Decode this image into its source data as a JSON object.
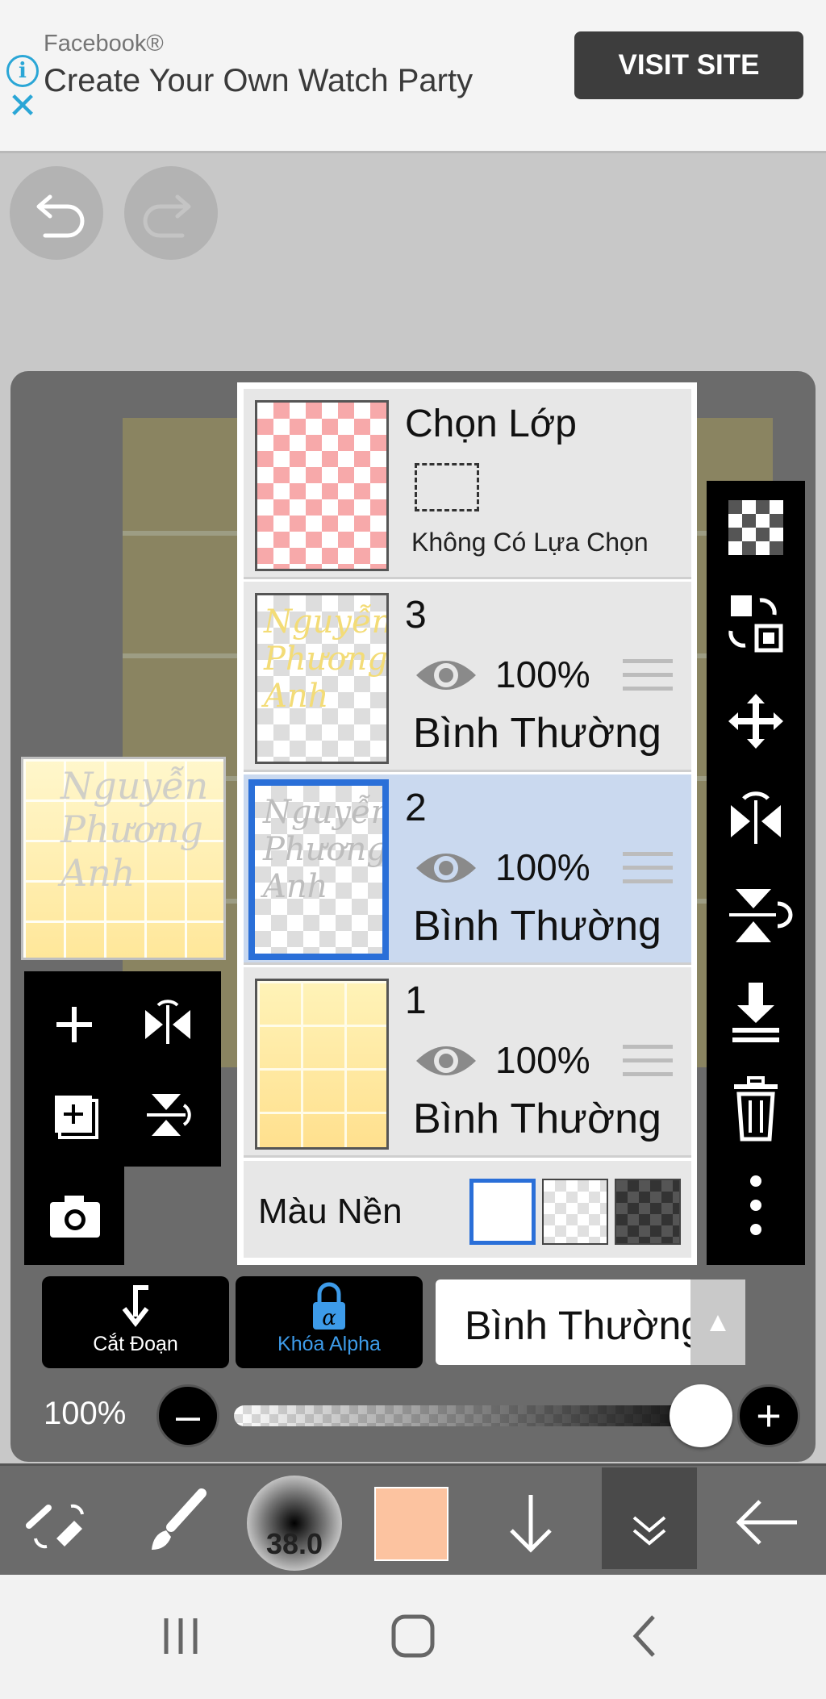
{
  "ad": {
    "brand": "Facebook®",
    "headline": "Create Your Own Watch Party",
    "cta": "VISIT SITE"
  },
  "layers_panel": {
    "selection": {
      "title": "Chọn Lớp",
      "status": "Không Có Lựa Chọn"
    },
    "layers": [
      {
        "name": "3",
        "opacity": "100%",
        "blend": "Bình Thường",
        "thumb_text": "Nguyễn Phương Anh"
      },
      {
        "name": "2",
        "opacity": "100%",
        "blend": "Bình Thường",
        "thumb_text": "Nguyễn Phương Anh"
      },
      {
        "name": "1",
        "opacity": "100%",
        "blend": "Bình Thường"
      }
    ],
    "background": {
      "label": "Màu Nền",
      "selected": "white"
    }
  },
  "preview": {
    "text": "Nguyễn Phương Anh"
  },
  "bottom_controls": {
    "clip_label": "Cắt Đoạn",
    "alpha_lock_label": "Khóa Alpha",
    "alpha_lock_icon": "α",
    "blend_mode": "Bình Thường",
    "opacity_label": "100%",
    "opacity_value": 1.0
  },
  "toolbar": {
    "brush_size": "38.0",
    "color": "#fcc3a0"
  },
  "colors": {
    "accent": "#2a6fd8",
    "ad_info": "#2aa6d6"
  }
}
